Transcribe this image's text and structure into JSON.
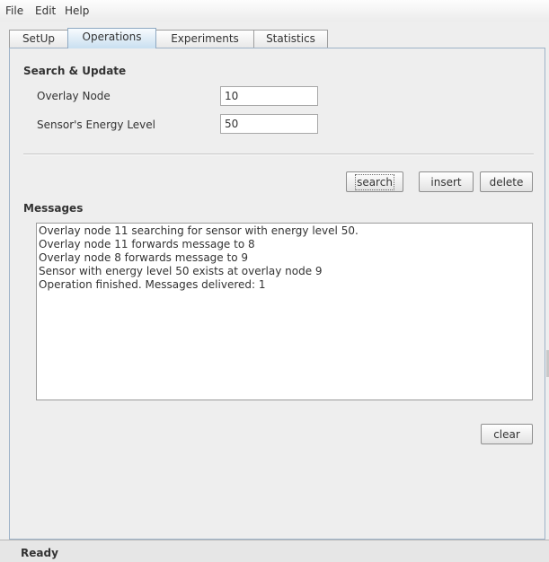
{
  "menu": {
    "file": "File",
    "edit": "Edit",
    "help": "Help"
  },
  "tabs": [
    {
      "label": "SetUp"
    },
    {
      "label": "Operations",
      "selected": true
    },
    {
      "label": "Experiments"
    },
    {
      "label": "Statistics"
    }
  ],
  "search_update": {
    "title": "Search & Update",
    "overlay_node_label": "Overlay Node",
    "overlay_node_value": "10",
    "energy_label": "Sensor's Energy Level",
    "energy_value": "50"
  },
  "actions": {
    "search": "search",
    "insert": "insert",
    "delete": "delete"
  },
  "messages": {
    "title": "Messages",
    "lines": [
      "Overlay node 11 searching for sensor with energy level 50.",
      "Overlay node 11 forwards message to 8",
      "Overlay node 8 forwards message to 9",
      "Sensor with energy level 50 exists at overlay node 9",
      "Operation finished. Messages delivered: 1"
    ],
    "clear": "clear"
  },
  "status": {
    "text": "Ready"
  },
  "colors": {
    "selected_tab": "#c9dff0",
    "panel_border": "#9eb3c8"
  }
}
